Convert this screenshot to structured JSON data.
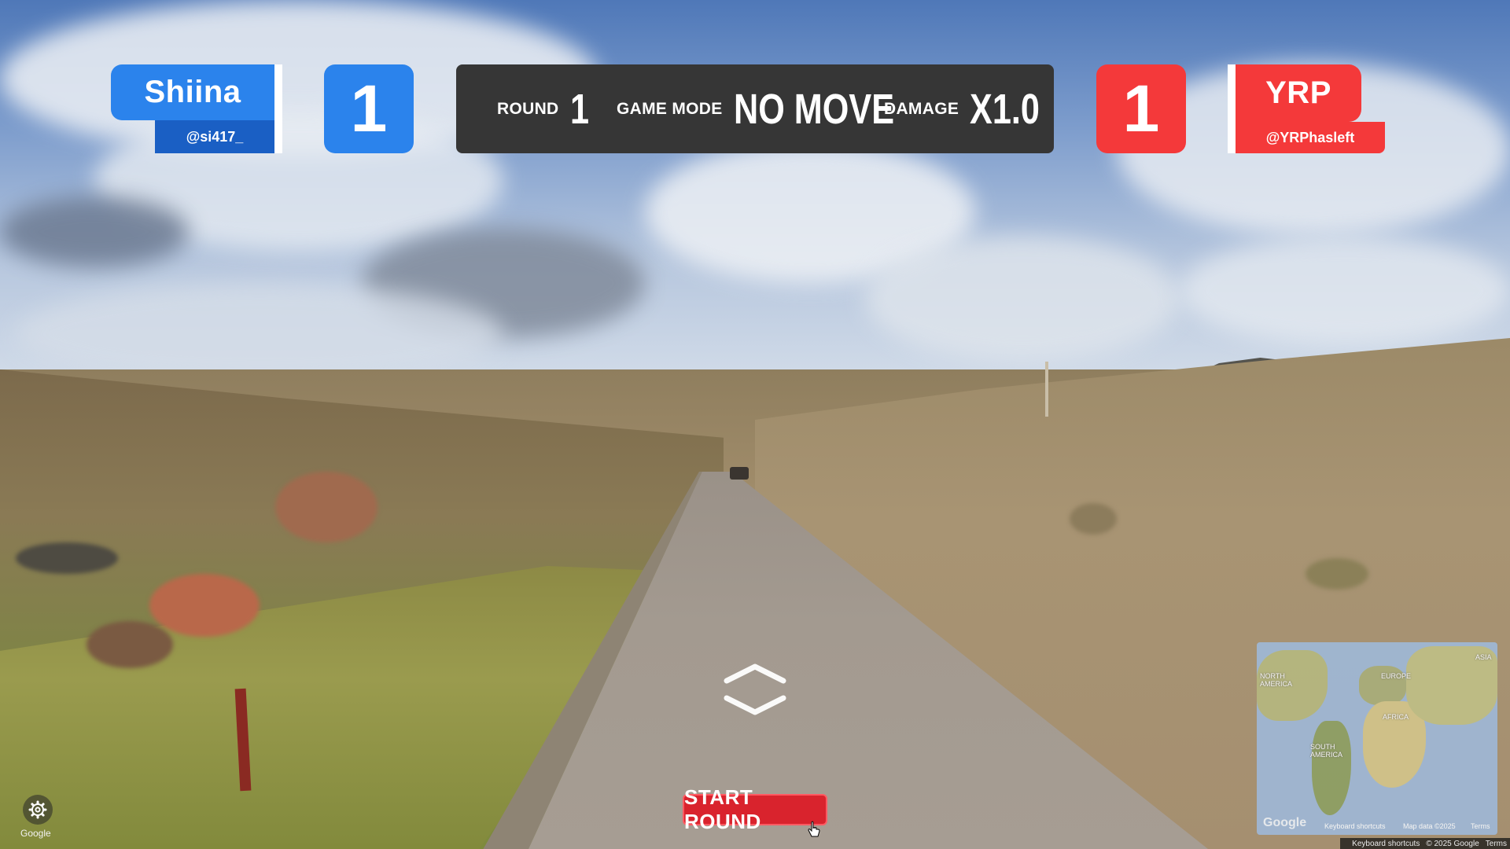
{
  "players": {
    "left": {
      "name": "Shiina",
      "handle": "@si417_",
      "score": "1",
      "color": "#2b83ec"
    },
    "right": {
      "name": "YRP",
      "handle": "@YRPhasleft",
      "score": "1",
      "color": "#f4393a"
    }
  },
  "info_bar": {
    "round_label": "ROUND",
    "round_value": "1",
    "mode_label": "GAME MODE",
    "mode_value": "NO MOVE",
    "damage_label": "DAMAGE",
    "damage_value": "X1.0"
  },
  "controls": {
    "start_button": "START ROUND",
    "settings_icon": "gear-icon",
    "google_label": "Google"
  },
  "minimap": {
    "labels": {
      "north_america": "NORTH AMERICA",
      "europe": "EUROPE",
      "asia": "ASIA",
      "africa": "AFRICA",
      "south_america": "SOUTH AMERICA"
    },
    "google_logo": "Google",
    "keyboard_shortcuts": "Keyboard shortcuts",
    "map_data": "Map data ©2025",
    "terms": "Terms"
  },
  "attribution": {
    "keyboard_shortcuts": "Keyboard shortcuts",
    "copyright": "© 2025 Google",
    "terms": "Terms"
  }
}
